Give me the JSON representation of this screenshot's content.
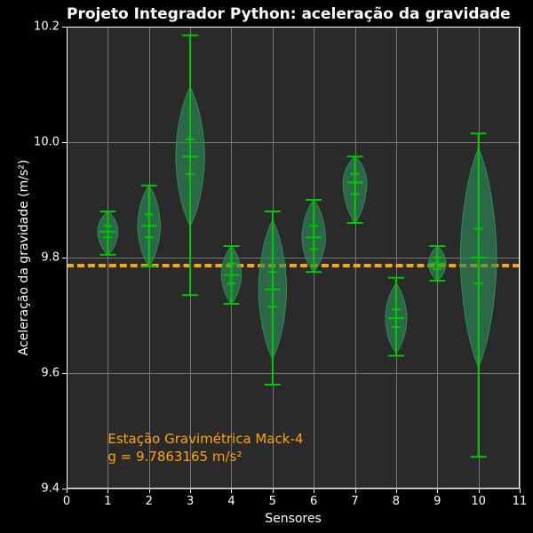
{
  "title": "Projeto Integrador Python: aceleração da gravidade",
  "xlabel": "Sensores",
  "ylabel": "Aceleração da gravidade (m/s²)",
  "xlim": [
    0,
    11
  ],
  "ylim": [
    9.4,
    10.2
  ],
  "xticks": [
    0,
    1,
    2,
    3,
    4,
    5,
    6,
    7,
    8,
    9,
    10,
    11
  ],
  "yticks": [
    9.4,
    9.6,
    9.8,
    10.0,
    10.2
  ],
  "ref_value": 9.7863165,
  "annotation": {
    "line1": "Estação Gravimétrica Mack-4",
    "line2": "g = 9.7863165 m/s²"
  },
  "chart_data": {
    "type": "violin",
    "xlabel": "Sensores",
    "ylabel": "Aceleração da gravidade (m/s²)",
    "xlim": [
      0,
      11
    ],
    "ylim": [
      9.4,
      10.2
    ],
    "reference_line": 9.7863165,
    "series": [
      {
        "sensor": 1,
        "median": 9.845,
        "q1": 9.835,
        "q3": 9.855,
        "min": 9.805,
        "max": 9.88,
        "width": 0.5
      },
      {
        "sensor": 2,
        "median": 9.855,
        "q1": 9.835,
        "q3": 9.875,
        "min": 9.785,
        "max": 9.925,
        "width": 0.55
      },
      {
        "sensor": 3,
        "median": 9.975,
        "q1": 9.945,
        "q3": 10.005,
        "min": 9.735,
        "max": 10.185,
        "width": 0.7
      },
      {
        "sensor": 4,
        "median": 9.77,
        "q1": 9.755,
        "q3": 9.79,
        "min": 9.72,
        "max": 9.82,
        "width": 0.48
      },
      {
        "sensor": 5,
        "median": 9.745,
        "q1": 9.715,
        "q3": 9.775,
        "min": 9.58,
        "max": 9.88,
        "width": 0.68
      },
      {
        "sensor": 6,
        "median": 9.835,
        "q1": 9.815,
        "q3": 9.855,
        "min": 9.775,
        "max": 9.9,
        "width": 0.57
      },
      {
        "sensor": 7,
        "median": 9.93,
        "q1": 9.91,
        "q3": 9.945,
        "min": 9.86,
        "max": 9.975,
        "width": 0.58
      },
      {
        "sensor": 8,
        "median": 9.695,
        "q1": 9.68,
        "q3": 9.71,
        "min": 9.63,
        "max": 9.765,
        "width": 0.52
      },
      {
        "sensor": 9,
        "median": 9.79,
        "q1": 9.78,
        "q3": 9.8,
        "min": 9.76,
        "max": 9.82,
        "width": 0.42
      },
      {
        "sensor": 10,
        "median": 9.8,
        "q1": 9.755,
        "q3": 9.85,
        "min": 9.455,
        "max": 10.015,
        "width": 0.88
      }
    ]
  }
}
